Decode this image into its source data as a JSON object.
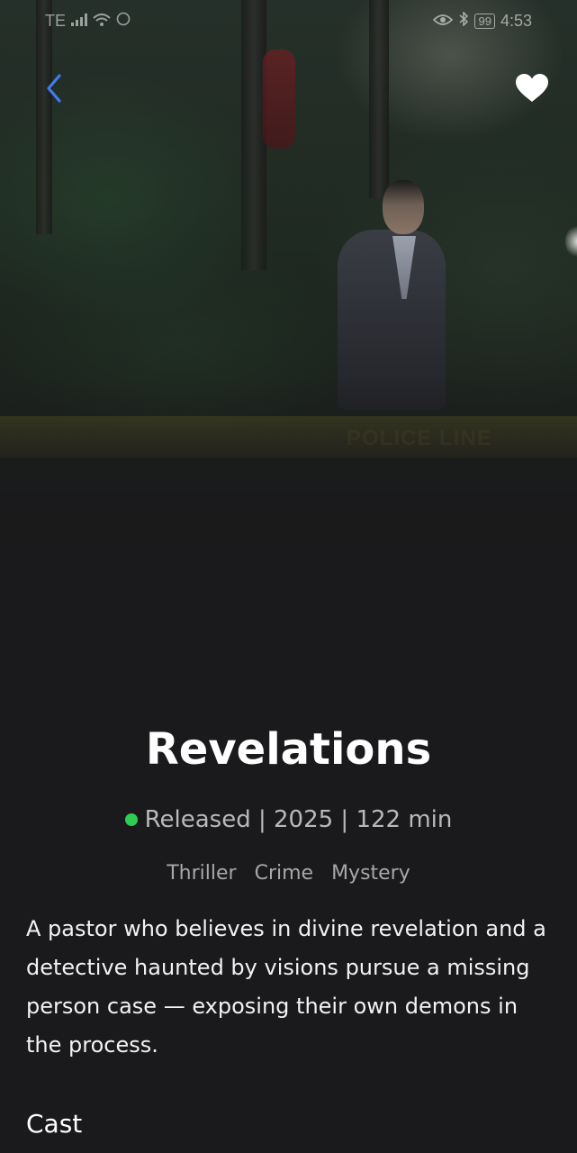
{
  "status_bar": {
    "carrier": "TE",
    "time": "4:53",
    "battery_level": "99",
    "icons": [
      "signal-icon",
      "wifi-icon",
      "whatsapp-icon",
      "eye-icon",
      "bluetooth-icon",
      "battery-icon"
    ]
  },
  "navigation": {
    "back_icon": "chevron-left-icon",
    "favorite_icon": "heart-icon"
  },
  "movie": {
    "title": "Revelations",
    "status": "Released",
    "status_color": "#2ecc52",
    "year": "2025",
    "runtime": "122 min",
    "genres": [
      "Thriller",
      "Crime",
      "Mystery"
    ],
    "overview": "A pastor who believes in divine revelation and a detective haunted by visions pursue a missing person case — exposing their own demons in the process."
  },
  "sections": {
    "cast_heading": "Cast"
  },
  "colors": {
    "background": "#1a191b",
    "accent_back": "#3f7cf2",
    "favorite": "#ffffff"
  }
}
